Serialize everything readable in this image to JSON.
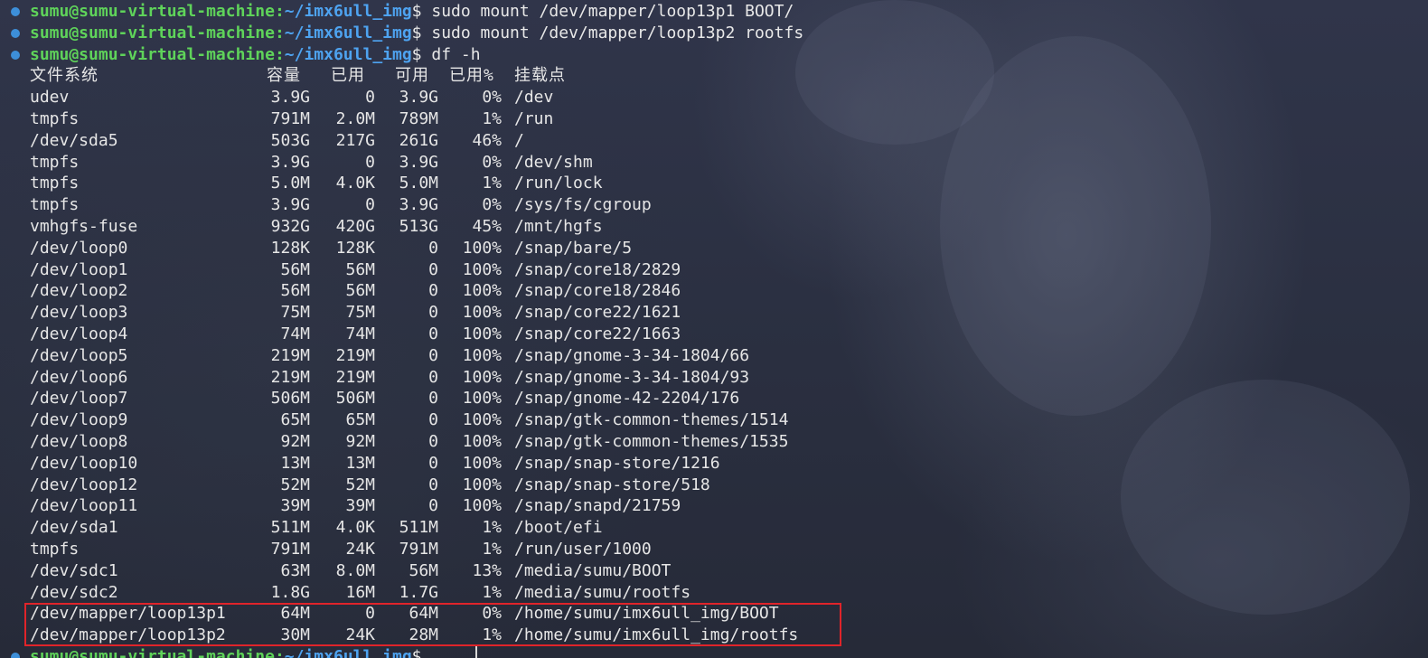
{
  "prompt": {
    "user_host": "sumu@sumu-virtual-machine",
    "path": "~/imx6ull_img",
    "symbol": "$"
  },
  "commands": [
    "sudo mount /dev/mapper/loop13p1 BOOT/",
    "sudo mount /dev/mapper/loop13p2 rootfs",
    "df -h"
  ],
  "df_header": {
    "filesystem": "文件系统",
    "size": "容量",
    "used": "已用",
    "avail": "可用",
    "use_pct": "已用%",
    "mount": "挂载点"
  },
  "df_rows": [
    [
      "udev",
      "3.9G",
      "0",
      "3.9G",
      "0%",
      "/dev"
    ],
    [
      "tmpfs",
      "791M",
      "2.0M",
      "789M",
      "1%",
      "/run"
    ],
    [
      "/dev/sda5",
      "503G",
      "217G",
      "261G",
      "46%",
      "/"
    ],
    [
      "tmpfs",
      "3.9G",
      "0",
      "3.9G",
      "0%",
      "/dev/shm"
    ],
    [
      "tmpfs",
      "5.0M",
      "4.0K",
      "5.0M",
      "1%",
      "/run/lock"
    ],
    [
      "tmpfs",
      "3.9G",
      "0",
      "3.9G",
      "0%",
      "/sys/fs/cgroup"
    ],
    [
      "vmhgfs-fuse",
      "932G",
      "420G",
      "513G",
      "45%",
      "/mnt/hgfs"
    ],
    [
      "/dev/loop0",
      "128K",
      "128K",
      "0",
      "100%",
      "/snap/bare/5"
    ],
    [
      "/dev/loop1",
      "56M",
      "56M",
      "0",
      "100%",
      "/snap/core18/2829"
    ],
    [
      "/dev/loop2",
      "56M",
      "56M",
      "0",
      "100%",
      "/snap/core18/2846"
    ],
    [
      "/dev/loop3",
      "75M",
      "75M",
      "0",
      "100%",
      "/snap/core22/1621"
    ],
    [
      "/dev/loop4",
      "74M",
      "74M",
      "0",
      "100%",
      "/snap/core22/1663"
    ],
    [
      "/dev/loop5",
      "219M",
      "219M",
      "0",
      "100%",
      "/snap/gnome-3-34-1804/66"
    ],
    [
      "/dev/loop6",
      "219M",
      "219M",
      "0",
      "100%",
      "/snap/gnome-3-34-1804/93"
    ],
    [
      "/dev/loop7",
      "506M",
      "506M",
      "0",
      "100%",
      "/snap/gnome-42-2204/176"
    ],
    [
      "/dev/loop9",
      "65M",
      "65M",
      "0",
      "100%",
      "/snap/gtk-common-themes/1514"
    ],
    [
      "/dev/loop8",
      "92M",
      "92M",
      "0",
      "100%",
      "/snap/gtk-common-themes/1535"
    ],
    [
      "/dev/loop10",
      "13M",
      "13M",
      "0",
      "100%",
      "/snap/snap-store/1216"
    ],
    [
      "/dev/loop12",
      "52M",
      "52M",
      "0",
      "100%",
      "/snap/snap-store/518"
    ],
    [
      "/dev/loop11",
      "39M",
      "39M",
      "0",
      "100%",
      "/snap/snapd/21759"
    ],
    [
      "/dev/sda1",
      "511M",
      "4.0K",
      "511M",
      "1%",
      "/boot/efi"
    ],
    [
      "tmpfs",
      "791M",
      "24K",
      "791M",
      "1%",
      "/run/user/1000"
    ],
    [
      "/dev/sdc1",
      "63M",
      "8.0M",
      "56M",
      "13%",
      "/media/sumu/BOOT"
    ],
    [
      "/dev/sdc2",
      "1.8G",
      "16M",
      "1.7G",
      "1%",
      "/media/sumu/rootfs"
    ],
    [
      "/dev/mapper/loop13p1",
      "64M",
      "0",
      "64M",
      "0%",
      "/home/sumu/imx6ull_img/BOOT"
    ],
    [
      "/dev/mapper/loop13p2",
      "30M",
      "24K",
      "28M",
      "1%",
      "/home/sumu/imx6ull_img/rootfs"
    ]
  ],
  "colors": {
    "prompt_user": "#5fd35a",
    "prompt_path": "#4ea3f0",
    "bullet": "#3d8fd9",
    "highlight_box": "#e0242a",
    "text": "#e6e6e6"
  }
}
